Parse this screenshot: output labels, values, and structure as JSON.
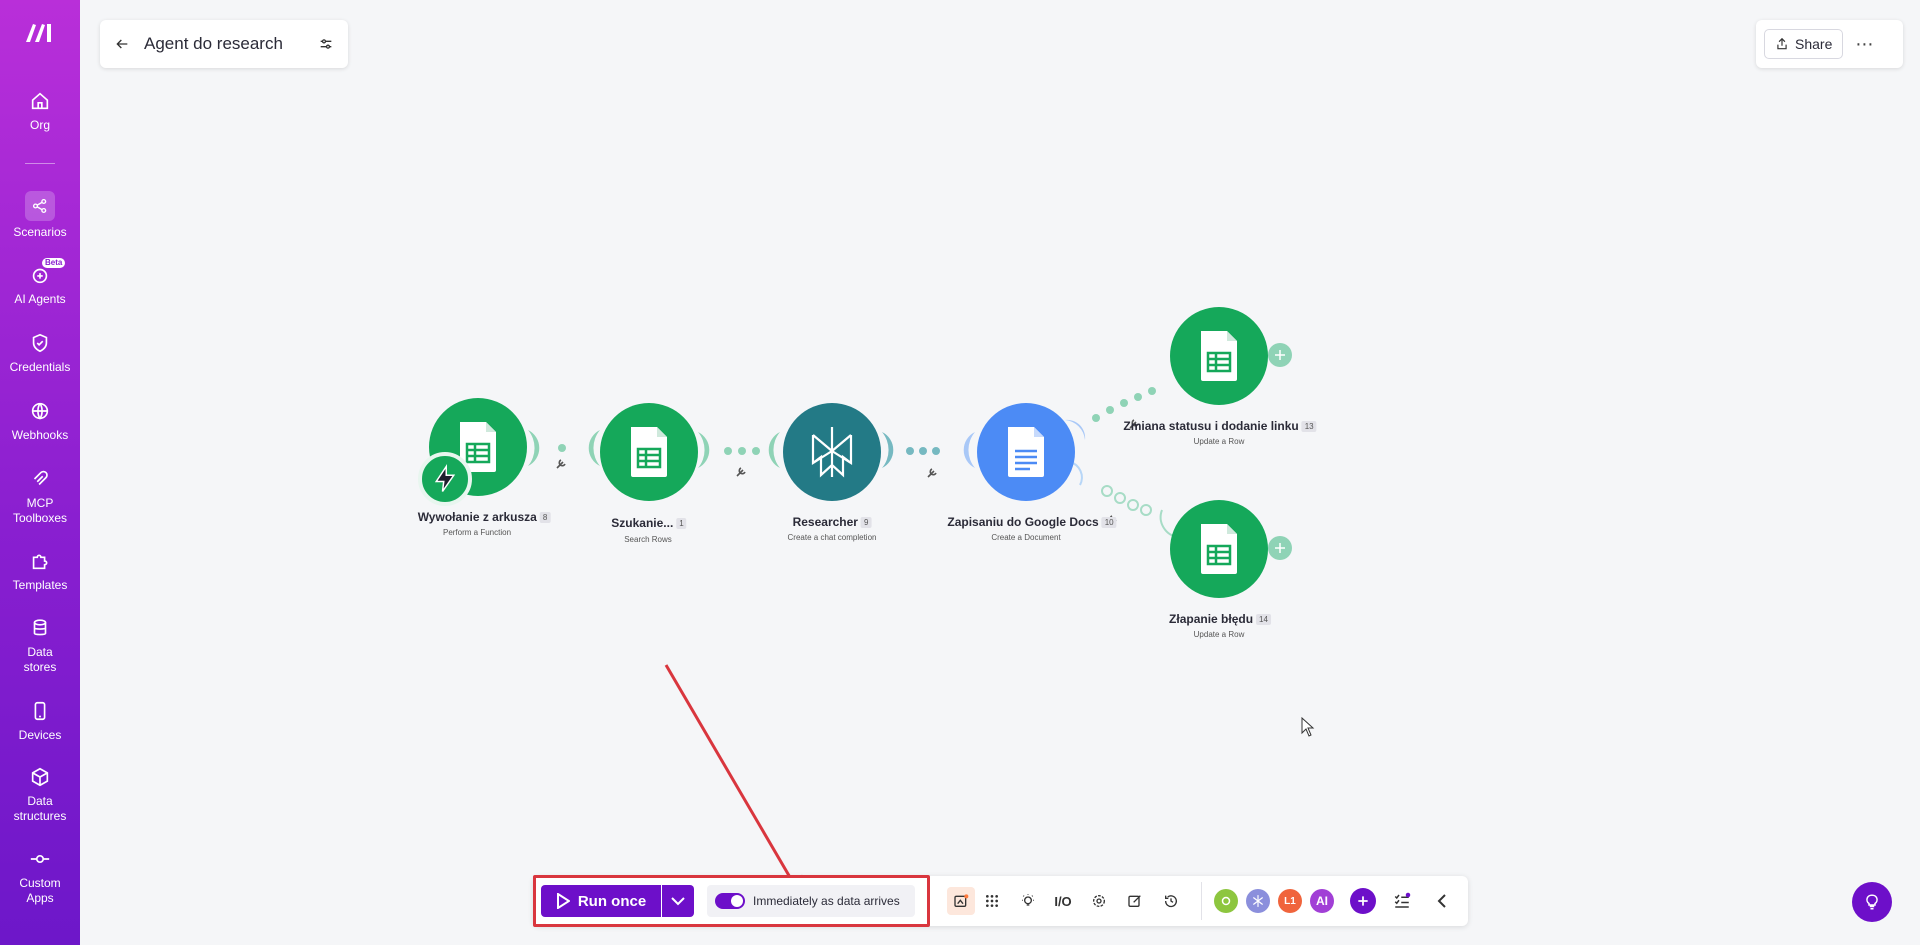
{
  "sidebar": {
    "items": [
      {
        "label": "Org",
        "icon": "home-icon"
      },
      {
        "label": "Scenarios",
        "icon": "share-nodes-icon"
      },
      {
        "label": "AI Agents",
        "icon": "ai-agents-icon",
        "badge": "Beta"
      },
      {
        "label": "Credentials",
        "icon": "shield-check-icon"
      },
      {
        "label": "Webhooks",
        "icon": "globe-icon"
      },
      {
        "label": "MCP Toolboxes",
        "icon": "mcp-icon"
      },
      {
        "label": "Templates",
        "icon": "puzzle-icon"
      },
      {
        "label": "Data stores",
        "icon": "database-icon"
      },
      {
        "label": "Devices",
        "icon": "mobile-icon"
      },
      {
        "label": "Data structures",
        "icon": "cube-icon"
      },
      {
        "label": "Custom Apps",
        "icon": "commit-icon"
      }
    ]
  },
  "header": {
    "title": "Agent do research",
    "share_label": "Share"
  },
  "nodes": [
    {
      "label": "Wywołanie z arkusza",
      "count": "8",
      "sub": "Perform a Function"
    },
    {
      "label": "Szukanie...",
      "count": "1",
      "sub": "Search Rows"
    },
    {
      "label": "Researcher",
      "count": "9",
      "sub": "Create a chat completion"
    },
    {
      "label": "Zapisaniu do Google Docs",
      "count": "10",
      "sub": "Create a Document"
    },
    {
      "label": "Zmiana statusu i dodanie linku",
      "count": "13",
      "sub": "Update a Row"
    },
    {
      "label": "Złapanie błędu",
      "count": "14",
      "sub": "Update a Row"
    }
  ],
  "toolbar": {
    "run_label": "Run once",
    "schedule_label": "Immediately as data arrives",
    "io_label": "I/O",
    "ai_label": "AI",
    "l1_label": "L1"
  },
  "colors": {
    "accent": "#6d0fc9",
    "sheets_green": "#15a85a",
    "docs_blue": "#4c8bf5",
    "researcher_teal": "#237a86",
    "annotation_red": "#d9363e"
  }
}
